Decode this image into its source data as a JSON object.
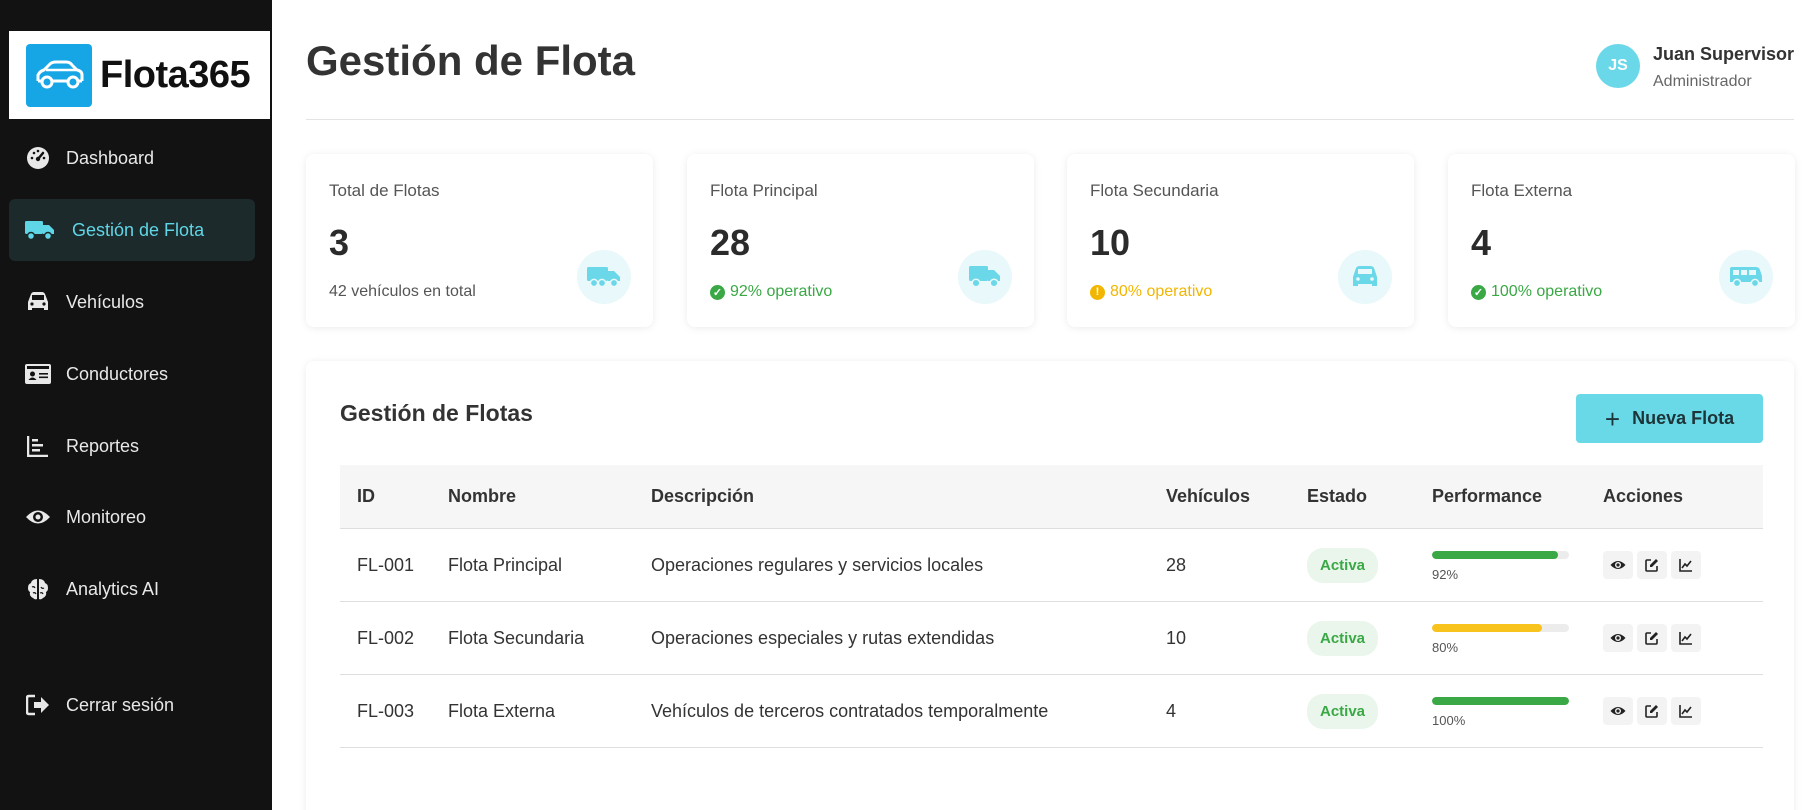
{
  "app": {
    "logo_text": "Flota365"
  },
  "sidebar": {
    "items": [
      {
        "label": "Dashboard",
        "icon": "gauge-icon"
      },
      {
        "label": "Gestión de Flota",
        "icon": "truck-icon",
        "active": true
      },
      {
        "label": "Vehículos",
        "icon": "car-icon"
      },
      {
        "label": "Conductores",
        "icon": "id-card-icon"
      },
      {
        "label": "Reportes",
        "icon": "bar-chart-icon"
      },
      {
        "label": "Monitoreo",
        "icon": "eye-icon"
      },
      {
        "label": "Analytics AI",
        "icon": "brain-icon"
      }
    ],
    "logout_label": "Cerrar sesión"
  },
  "header": {
    "title": "Gestión de Flota",
    "user": {
      "initials": "JS",
      "name": "Juan Supervisor",
      "role": "Administrador"
    }
  },
  "stats": [
    {
      "label": "Total de Flotas",
      "value": "3",
      "sub": "42 vehículos en total",
      "status": "none",
      "icon": "truck-icon"
    },
    {
      "label": "Flota Principal",
      "value": "28",
      "sub": "92% operativo",
      "status": "ok",
      "icon": "truck-icon"
    },
    {
      "label": "Flota Secundaria",
      "value": "10",
      "sub": "80% operativo",
      "status": "warning",
      "icon": "car-icon"
    },
    {
      "label": "Flota Externa",
      "value": "4",
      "sub": "100% operativo",
      "status": "ok",
      "icon": "van-icon"
    }
  ],
  "fleets": {
    "title": "Gestión de Flotas",
    "new_button": "Nueva Flota",
    "columns": [
      "ID",
      "Nombre",
      "Descripción",
      "Vehículos",
      "Estado",
      "Performance",
      "Acciones"
    ],
    "rows": [
      {
        "id": "FL-001",
        "name": "Flota Principal",
        "description": "Operaciones regulares y servicios locales",
        "vehicles": "28",
        "status": "Activa",
        "performance": 0.92,
        "performance_label": "92%",
        "bar_color": "#3aa845"
      },
      {
        "id": "FL-002",
        "name": "Flota Secundaria",
        "description": "Operaciones especiales y rutas extendidas",
        "vehicles": "10",
        "status": "Activa",
        "performance": 0.8,
        "performance_label": "80%",
        "bar_color": "#f7c31c"
      },
      {
        "id": "FL-003",
        "name": "Flota Externa",
        "description": "Vehículos de terceros contratados temporalmente",
        "vehicles": "4",
        "status": "Activa",
        "performance": 1.0,
        "performance_label": "100%",
        "bar_color": "#3aa845"
      }
    ]
  },
  "colors": {
    "accent": "#69d9e8",
    "sidebar_bg": "#121212",
    "ok": "#3aa845",
    "warning": "#f2b600"
  }
}
